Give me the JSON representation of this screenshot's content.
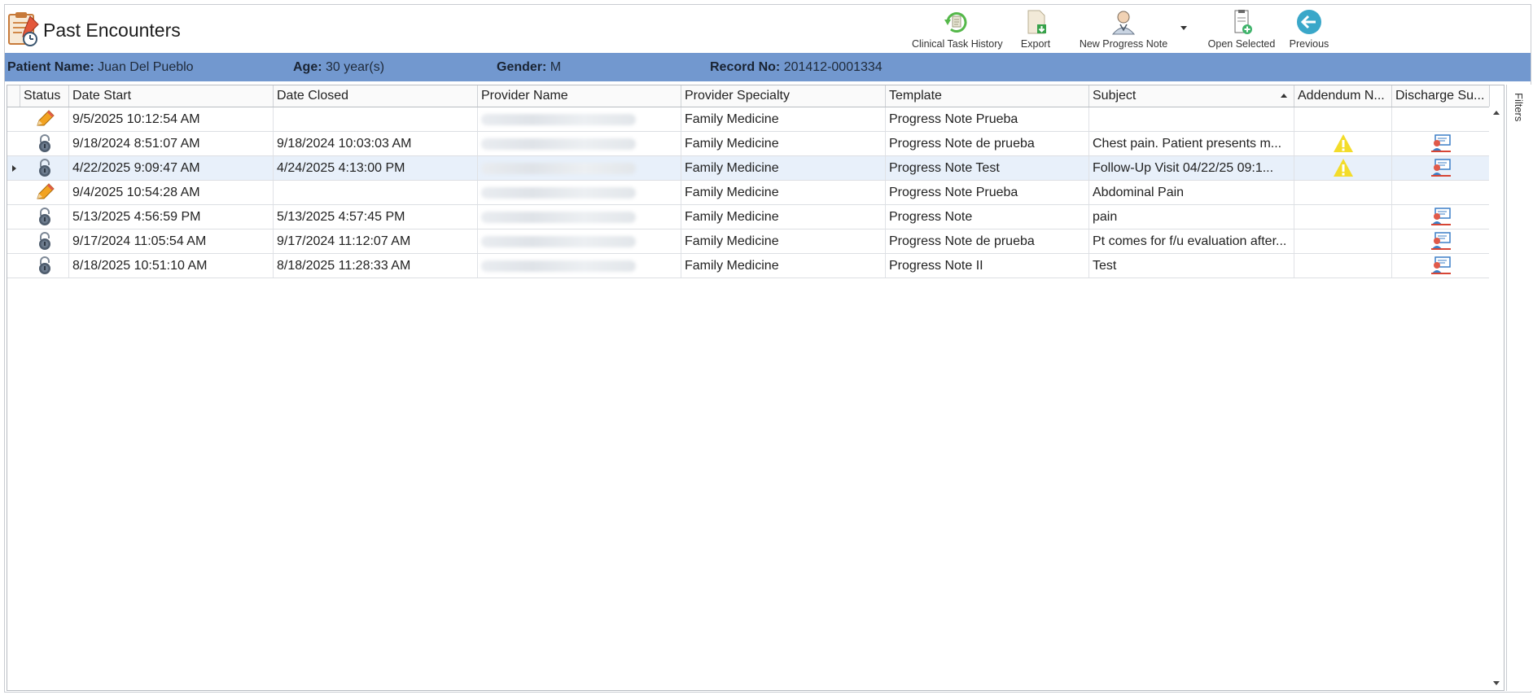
{
  "window": {
    "title": "Past Encounters"
  },
  "toolbar": {
    "clinical_task_history": "Clinical Task History",
    "export": "Export",
    "new_progress_note": "New Progress Note",
    "open_selected": "Open Selected",
    "previous": "Previous"
  },
  "patient": {
    "name_label": "Patient Name:",
    "name_value": "Juan Del Pueblo",
    "age_label": "Age:",
    "age_value": "30 year(s)",
    "gender_label": "Gender:",
    "gender_value": "M",
    "record_label": "Record No:",
    "record_value": "201412-0001334"
  },
  "grid": {
    "columns": [
      "Status",
      "Date Start",
      "Date Closed",
      "Provider Name",
      "Provider Specialty",
      "Template",
      "Subject",
      "Addendum N...",
      "Discharge Su..."
    ],
    "rows": [
      {
        "status_icon": "pencil-icon",
        "date_start": "9/5/2025 10:12:54 AM",
        "date_closed": "",
        "provider_specialty": "Family Medicine",
        "template": "Progress Note Prueba",
        "subject": "",
        "addendum": "",
        "discharge": ""
      },
      {
        "status_icon": "lock-icon",
        "date_start": "9/18/2024 8:51:07 AM",
        "date_closed": "9/18/2024 10:03:03 AM",
        "provider_specialty": "Family Medicine",
        "template": "Progress Note de prueba",
        "subject": "  Chest pain. Patient presents m...",
        "addendum": "warning-icon",
        "discharge": "discharge-icon"
      },
      {
        "status_icon": "lock-icon",
        "date_start": "4/22/2025 9:09:47 AM",
        "date_closed": "4/24/2025 4:13:00 PM",
        "provider_specialty": "Family Medicine",
        "template": "Progress Note Test",
        "subject": "  Follow-Up Visit   04/22/25 09:1...",
        "addendum": "warning-icon",
        "discharge": "discharge-icon",
        "selected": true
      },
      {
        "status_icon": "pencil-icon",
        "date_start": "9/4/2025 10:54:28 AM",
        "date_closed": "",
        "provider_specialty": "Family Medicine",
        "template": "Progress Note Prueba",
        "subject": "Abdominal Pain",
        "addendum": "",
        "discharge": ""
      },
      {
        "status_icon": "lock-icon",
        "date_start": "5/13/2025 4:56:59 PM",
        "date_closed": "5/13/2025 4:57:45 PM",
        "provider_specialty": "Family Medicine",
        "template": "Progress Note",
        "subject": "pain",
        "addendum": "",
        "discharge": "discharge-icon"
      },
      {
        "status_icon": "lock-icon",
        "date_start": "9/17/2024 11:05:54 AM",
        "date_closed": "9/17/2024 11:12:07 AM",
        "provider_specialty": "Family Medicine",
        "template": "Progress Note de prueba",
        "subject": "Pt comes for f/u evaluation after...",
        "addendum": "",
        "discharge": "discharge-icon"
      },
      {
        "status_icon": "lock-icon",
        "date_start": "8/18/2025 10:51:10 AM",
        "date_closed": "8/18/2025 11:28:33 AM",
        "provider_specialty": "Family Medicine",
        "template": "Progress Note II",
        "subject": "Test",
        "addendum": "",
        "discharge": "discharge-icon"
      }
    ]
  },
  "filters": {
    "label": "Filters"
  },
  "colors": {
    "patient_bar": "#7298cf",
    "selected_row": "#e8f0fa",
    "accent": "#3aa7c9"
  }
}
